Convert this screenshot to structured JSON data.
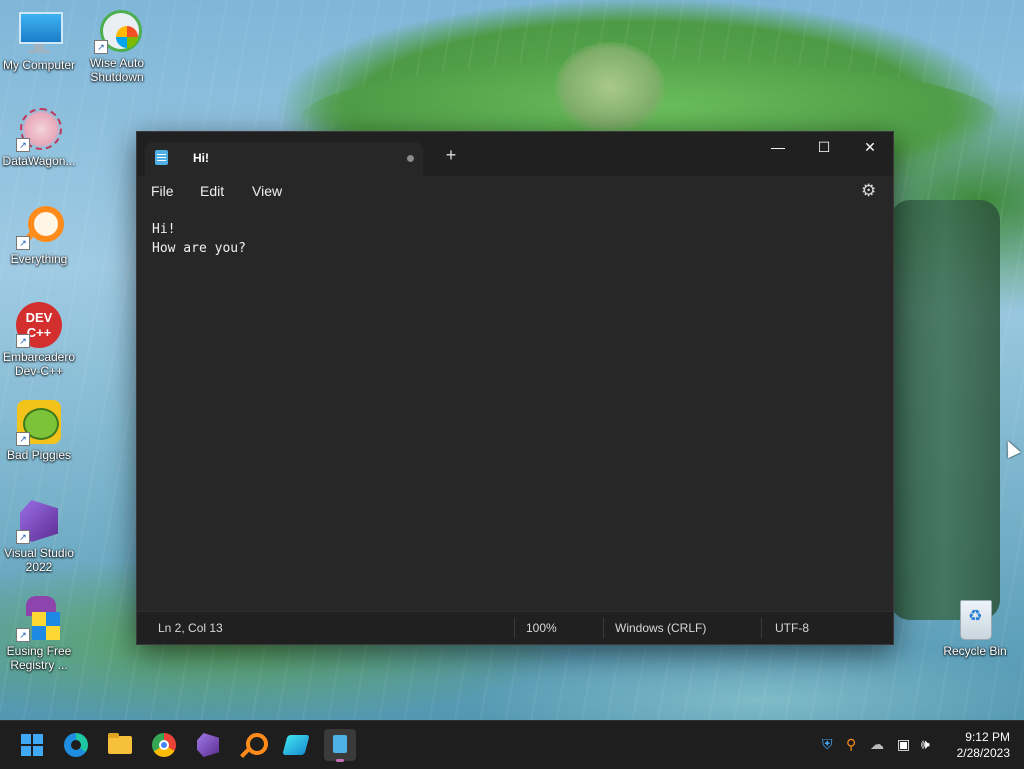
{
  "desktop": {
    "icons": [
      {
        "label": "My Computer",
        "icon": "monitor-icon"
      },
      {
        "label": "Wise Auto Shutdown",
        "icon": "clock-shutdown-icon"
      },
      {
        "label": "DataWagon...",
        "icon": "flower-icon"
      },
      {
        "label": "Everything",
        "icon": "magnifier-icon"
      },
      {
        "label": "Embarcadero Dev-C++",
        "icon": "devcpp-icon"
      },
      {
        "label": "Bad Piggies",
        "icon": "green-pig-icon"
      },
      {
        "label": "Visual Studio 2022",
        "icon": "visual-studio-icon"
      },
      {
        "label": "Eusing Free Registry ...",
        "icon": "registry-cleaner-icon"
      },
      {
        "label": "Recycle Bin",
        "icon": "recycle-bin-icon"
      }
    ]
  },
  "notepad": {
    "tab_title": "Hi!",
    "new_tab_symbol": "+",
    "window_controls": {
      "minimize": "—",
      "maximize": "☐",
      "close": "✕"
    },
    "menu": [
      "File",
      "Edit",
      "View"
    ],
    "content_lines": [
      "Hi!",
      "How are you?"
    ],
    "status": {
      "position": "Ln 2, Col 13",
      "zoom": "100%",
      "line_ending": "Windows (CRLF)",
      "encoding": "UTF-8"
    }
  },
  "taskbar": {
    "apps": [
      {
        "name": "start",
        "icon": "windows-start-icon"
      },
      {
        "name": "edge",
        "icon": "edge-icon"
      },
      {
        "name": "file-explorer",
        "icon": "folder-icon"
      },
      {
        "name": "chrome",
        "icon": "chrome-icon"
      },
      {
        "name": "visual-studio",
        "icon": "visual-studio-icon"
      },
      {
        "name": "everything",
        "icon": "magnifier-icon"
      },
      {
        "name": "app",
        "icon": "blue-app-icon"
      },
      {
        "name": "notepad",
        "icon": "notepad-icon",
        "active": true
      }
    ],
    "tray_icons": [
      "shield-icon",
      "magnifier-icon",
      "cloud-icon",
      "network-icon",
      "volume-icon"
    ],
    "time": "9:12 PM",
    "date": "2/28/2023"
  },
  "colors": {
    "window_bg": "#272727",
    "titlebar_bg": "#202020",
    "taskbar_bg": "#1e1e1e",
    "accent": "#4fb0e8"
  }
}
